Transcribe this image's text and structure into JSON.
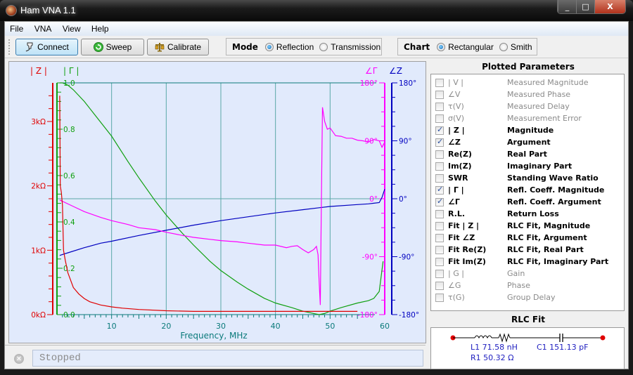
{
  "window": {
    "title": "Ham VNA 1.1",
    "minimize": "_",
    "maximize": "□",
    "close": "X"
  },
  "menu": [
    {
      "label": "File",
      "accel": "F"
    },
    {
      "label": "VNA",
      "accel": "N"
    },
    {
      "label": "View",
      "accel": "V"
    },
    {
      "label": "Help",
      "accel": "H"
    }
  ],
  "toolbar": {
    "connect": "Connect",
    "sweep": "Sweep",
    "calibrate": "Calibrate",
    "mode_label": "Mode",
    "mode_options": [
      "Reflection",
      "Transmission"
    ],
    "mode_selected": "Reflection",
    "chart_label": "Chart",
    "chart_options": [
      "Rectangular",
      "Smith"
    ],
    "chart_selected": "Rectangular"
  },
  "chart_data": {
    "type": "line",
    "xlabel": "Frequency, MHz",
    "xlim": [
      0,
      60
    ],
    "x_ticks": [
      10,
      20,
      30,
      40,
      50,
      60
    ],
    "axes": {
      "z_mag": {
        "label": "| Z |",
        "unit": "kΩ",
        "ticks": [
          "0kΩ",
          "1kΩ",
          "2kΩ",
          "3kΩ"
        ],
        "range": [
          0,
          3.6
        ],
        "color": "#e00000"
      },
      "gamma_mag": {
        "label": "| Γ |",
        "ticks": [
          "0.0",
          "0.2",
          "0.4",
          "0.6",
          "0.8",
          "1.0"
        ],
        "range": [
          0,
          1
        ],
        "color": "#10a010"
      },
      "gamma_arg": {
        "label": "∠Γ",
        "ticks": [
          "-180°",
          "-90°",
          "0°",
          "90°",
          "180°"
        ],
        "range": [
          -180,
          180
        ],
        "color": "#ff00ff"
      },
      "z_arg": {
        "label": "∠Z",
        "ticks": [
          "-180°",
          "-90°",
          "0°",
          "90°",
          "180°"
        ],
        "range": [
          -180,
          180
        ],
        "color": "#0000c0"
      }
    },
    "grid": true,
    "series": [
      {
        "name": "| Z |",
        "axis": "z_mag",
        "color": "#e00000",
        "x": [
          0.5,
          0.6,
          0.8,
          1.0,
          1.2,
          1.5,
          2,
          3,
          4,
          5,
          6,
          8,
          10,
          12,
          15,
          20,
          25,
          30,
          35,
          40,
          45,
          48,
          50,
          55
        ],
        "y": [
          3.4,
          2.0,
          1.9,
          1.7,
          1.0,
          0.85,
          0.65,
          0.42,
          0.32,
          0.25,
          0.2,
          0.15,
          0.12,
          0.1,
          0.08,
          0.06,
          0.05,
          0.05,
          0.05,
          0.05,
          0.05,
          0.05,
          0.05,
          0.05
        ]
      },
      {
        "name": "| Γ |",
        "axis": "gamma_mag",
        "color": "#10a010",
        "x": [
          0.5,
          1,
          2,
          3,
          5,
          7,
          10,
          13,
          15,
          18,
          20,
          23,
          25,
          28,
          30,
          33,
          35,
          38,
          40,
          43,
          45,
          47,
          48,
          49,
          50,
          52,
          55,
          57,
          58,
          59,
          59.7
        ],
        "y": [
          1.0,
          1.0,
          0.99,
          0.97,
          0.92,
          0.86,
          0.77,
          0.66,
          0.59,
          0.49,
          0.43,
          0.35,
          0.3,
          0.23,
          0.19,
          0.14,
          0.11,
          0.07,
          0.05,
          0.03,
          0.015,
          0.005,
          0.0,
          0.005,
          0.015,
          0.03,
          0.05,
          0.06,
          0.07,
          0.1,
          0.23
        ]
      },
      {
        "name": "∠Γ",
        "axis": "gamma_arg",
        "color": "#ff00ff",
        "x": [
          0.5,
          3,
          5,
          8,
          10,
          13,
          15,
          18,
          20,
          23,
          25,
          28,
          30,
          33,
          35,
          38,
          40,
          42,
          43,
          44,
          45,
          46,
          47,
          47.5,
          47.8,
          48,
          48.2,
          48.4,
          48.6,
          49,
          49.5,
          50,
          51,
          52,
          53,
          54,
          55,
          56,
          57,
          58,
          59,
          59.5,
          60
        ],
        "y": [
          -2,
          -12,
          -20,
          -29,
          -34,
          -40,
          -45,
          -48,
          -52,
          -57,
          -60,
          -63,
          -65,
          -67,
          -69,
          -72,
          -72,
          -76,
          -74,
          -73,
          -79,
          -84,
          -79,
          -74,
          -87,
          -130,
          -165,
          -8,
          142,
          120,
          108,
          110,
          98,
          97,
          94,
          94,
          91,
          90,
          88,
          92,
          90,
          80,
          88
        ]
      },
      {
        "name": "∠Z",
        "axis": "z_arg",
        "color": "#0000c0",
        "x": [
          0.5,
          2,
          5,
          8,
          10,
          15,
          20,
          25,
          30,
          35,
          40,
          45,
          48,
          50,
          55,
          57,
          58,
          59,
          59.5,
          60
        ],
        "y": [
          -88,
          -84,
          -76,
          -69,
          -66,
          -57,
          -49,
          -41,
          -34,
          -28,
          -22,
          -17,
          -14,
          -12,
          -9,
          -8,
          -7,
          -6,
          2,
          15
        ]
      }
    ]
  },
  "side": {
    "title": "Plotted Parameters",
    "params": [
      {
        "symbol": "| V |",
        "desc": "Measured Magnitude",
        "checked": false,
        "enabled": false
      },
      {
        "symbol": "∠V",
        "desc": "Measured Phase",
        "checked": false,
        "enabled": false
      },
      {
        "symbol": "τ(V)",
        "desc": "Measured Delay",
        "checked": false,
        "enabled": false
      },
      {
        "symbol": "σ(V)",
        "desc": "Measurement Error",
        "checked": false,
        "enabled": false
      },
      {
        "symbol": "| Z |",
        "desc": "Magnitude",
        "checked": true,
        "enabled": true
      },
      {
        "symbol": "∠Z",
        "desc": "Argument",
        "checked": true,
        "enabled": true
      },
      {
        "symbol": "Re(Z)",
        "desc": "Real Part",
        "checked": false,
        "enabled": true
      },
      {
        "symbol": "Im(Z)",
        "desc": "Imaginary Part",
        "checked": false,
        "enabled": true
      },
      {
        "symbol": "SWR",
        "desc": "Standing Wave Ratio",
        "checked": false,
        "enabled": true
      },
      {
        "symbol": "| Γ |",
        "desc": "Refl. Coeff. Magnitude",
        "checked": true,
        "enabled": true
      },
      {
        "symbol": "∠Γ",
        "desc": "Refl. Coeff. Argument",
        "checked": true,
        "enabled": true
      },
      {
        "symbol": "R.L.",
        "desc": "Return Loss",
        "checked": false,
        "enabled": true
      },
      {
        "symbol": "Fit | Z |",
        "desc": "RLC Fit, Magnitude",
        "checked": false,
        "enabled": true
      },
      {
        "symbol": "Fit ∠Z",
        "desc": "RLC Fit, Argument",
        "checked": false,
        "enabled": true
      },
      {
        "symbol": "Fit Re(Z)",
        "desc": "RLC Fit, Real Part",
        "checked": false,
        "enabled": true
      },
      {
        "symbol": "Fit Im(Z)",
        "desc": "RLC Fit, Imaginary Part",
        "checked": false,
        "enabled": true
      },
      {
        "symbol": "| G |",
        "desc": "Gain",
        "checked": false,
        "enabled": false
      },
      {
        "symbol": "∠G",
        "desc": "Phase",
        "checked": false,
        "enabled": false
      },
      {
        "symbol": "τ(G)",
        "desc": "Group Delay",
        "checked": false,
        "enabled": false
      }
    ],
    "rlc_title": "RLC Fit",
    "rlc": {
      "l1": "L1  71.58 nH",
      "r1": "R1  50.32 Ω",
      "c1": "C1  151.13 pF"
    }
  },
  "status": {
    "text": "Stopped"
  }
}
